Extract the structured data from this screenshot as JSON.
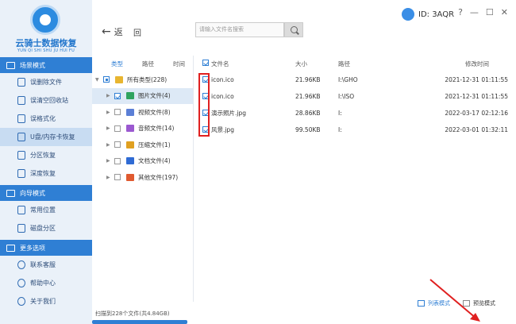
{
  "app": {
    "title": "云骑士数据恢复",
    "subtitle": "YUN QI SHI SHU JU HUI FU",
    "id_label": "ID: 3AQR"
  },
  "window_buttons": [
    "?",
    "—",
    "☐",
    "✕"
  ],
  "sidebar": {
    "sections": [
      {
        "title": "场景模式",
        "items": [
          {
            "label": "误删除文件",
            "active": false
          },
          {
            "label": "误清空回收站",
            "active": false
          },
          {
            "label": "误格式化",
            "active": false
          },
          {
            "label": "U盘/内存卡恢复",
            "active": true
          },
          {
            "label": "分区恢复",
            "active": false
          },
          {
            "label": "深度恢复",
            "active": false
          }
        ]
      },
      {
        "title": "向导模式",
        "items": [
          {
            "label": "常用位置",
            "active": false
          },
          {
            "label": "磁盘分区",
            "active": false
          }
        ]
      },
      {
        "title": "更多选项",
        "items": [
          {
            "label": "联系客服",
            "active": false
          },
          {
            "label": "帮助中心",
            "active": false
          },
          {
            "label": "关于我们",
            "active": false
          }
        ]
      }
    ]
  },
  "toolbar": {
    "back_label": "返",
    "back_arrow": "←",
    "forward_label": "回",
    "search_placeholder": "请输入文件名搜索"
  },
  "tree": {
    "tabs": [
      "类型",
      "路径",
      "时间"
    ],
    "root": {
      "label": "所有类型(228)"
    },
    "items": [
      {
        "label": "图片文件(4)",
        "color": "#2fa35f",
        "checked": true,
        "active": true
      },
      {
        "label": "视频文件(8)",
        "color": "#5b7fd6",
        "checked": false,
        "active": false
      },
      {
        "label": "音频文件(14)",
        "color": "#9b59d0",
        "checked": false,
        "active": false
      },
      {
        "label": "压缩文件(1)",
        "color": "#e0a020",
        "checked": false,
        "active": false
      },
      {
        "label": "文档文件(4)",
        "color": "#2f6bd4",
        "checked": false,
        "active": false
      },
      {
        "label": "其他文件(197)",
        "color": "#e05a30",
        "checked": false,
        "active": false
      }
    ]
  },
  "table": {
    "headers": {
      "name": "文件名",
      "size": "大小",
      "path": "路径",
      "date": "修改时间"
    },
    "rows": [
      {
        "name": "icon.ico",
        "size": "21.96KB",
        "path": "I:\\GHO",
        "date": "2021-12-31 01:11:55"
      },
      {
        "name": "icon.ico",
        "size": "21.96KB",
        "path": "I:\\ISO",
        "date": "2021-12-31 01:11:55"
      },
      {
        "name": "演示照片.jpg",
        "size": "28.86KB",
        "path": "I:",
        "date": "2022-03-17 02:12:16"
      },
      {
        "name": "风景.jpg",
        "size": "99.50KB",
        "path": "I:",
        "date": "2022-03-01 01:32:11"
      }
    ]
  },
  "status": {
    "scan_text": "扫描到228个文件(共4.84GB)"
  },
  "view_modes": [
    {
      "label": "列表模式",
      "active": true
    },
    {
      "label": "预览模式",
      "active": false
    }
  ],
  "colors": {
    "accent": "#2f7fd4",
    "highlight_box": "#e02020",
    "sidebar_bg": "#eaf1f9"
  }
}
